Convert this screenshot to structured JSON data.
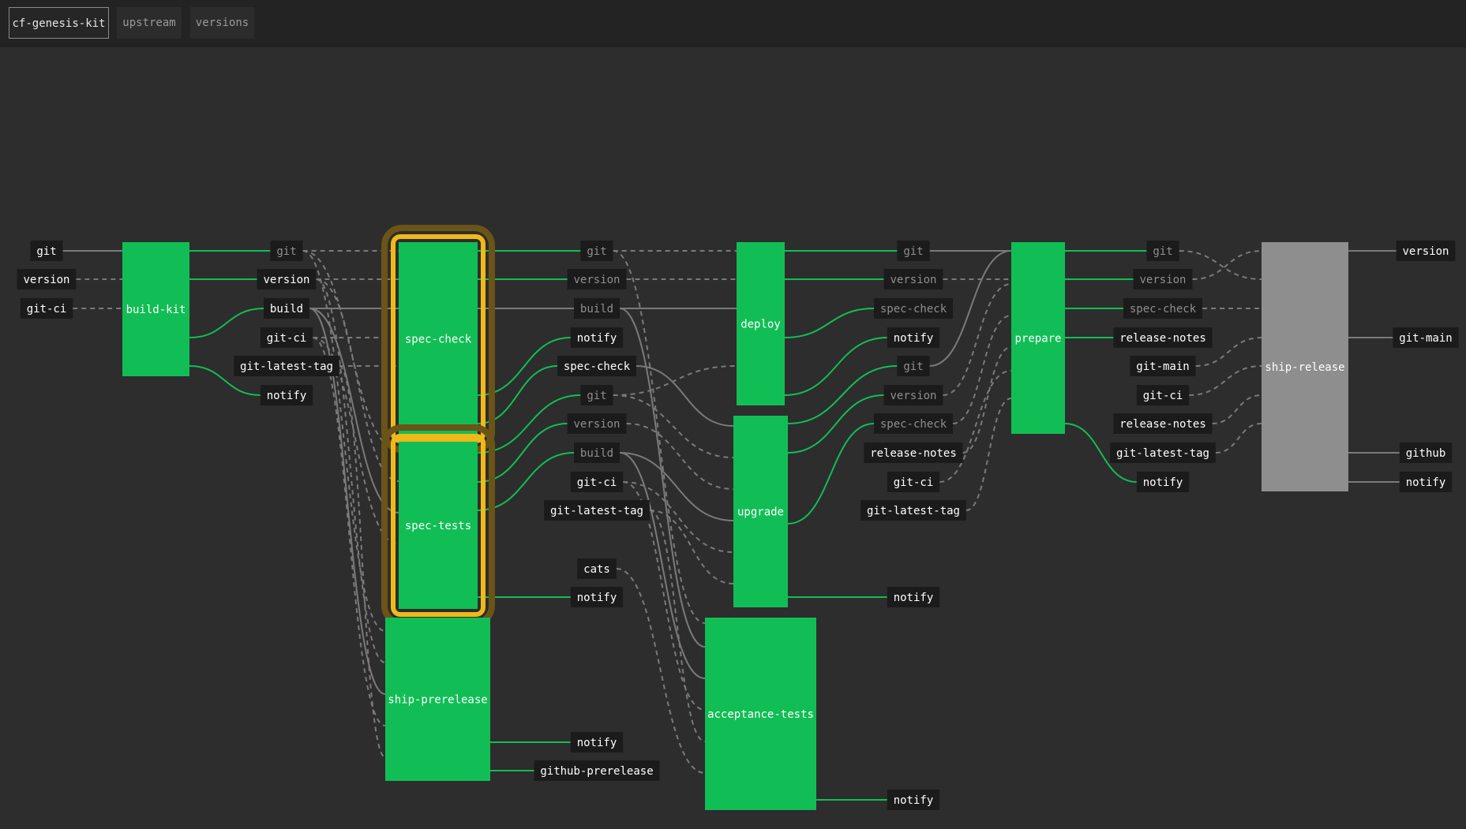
{
  "tabs": [
    {
      "label": "cf-genesis-kit",
      "active": true
    },
    {
      "label": "upstream",
      "active": false
    },
    {
      "label": "versions",
      "active": false
    }
  ],
  "colors": {
    "succeeded": "#11be55",
    "pending": "#8e8e8e",
    "running": "#f0b91a",
    "running_halo": "#6b5417",
    "label_bg": "#1b1b1b",
    "label_text": "#ffffff",
    "label_text_dim": "#8f8f8f",
    "edge": "#7a7a7a",
    "edge_green": "#11be55"
  },
  "jobs": [
    {
      "id": "build-kit",
      "label": "build-kit",
      "status": "succeeded"
    },
    {
      "id": "spec-check",
      "label": "spec-check",
      "status": "running"
    },
    {
      "id": "spec-tests",
      "label": "spec-tests",
      "status": "running"
    },
    {
      "id": "ship-prerelease",
      "label": "ship-prerelease",
      "status": "succeeded"
    },
    {
      "id": "deploy",
      "label": "deploy",
      "status": "succeeded"
    },
    {
      "id": "upgrade",
      "label": "upgrade",
      "status": "succeeded"
    },
    {
      "id": "acceptance-tests",
      "label": "acceptance-tests",
      "status": "succeeded"
    },
    {
      "id": "prepare",
      "label": "prepare",
      "status": "succeeded"
    },
    {
      "id": "ship-release",
      "label": "ship-release",
      "status": "pending"
    }
  ],
  "resources": [
    {
      "id": "r-c0-git",
      "text": "git",
      "dim": false
    },
    {
      "id": "r-c0-version",
      "text": "version",
      "dim": false
    },
    {
      "id": "r-c0-git-ci",
      "text": "git-ci",
      "dim": false
    },
    {
      "id": "r-c1-git",
      "text": "git",
      "dim": true
    },
    {
      "id": "r-c1-version",
      "text": "version",
      "dim": false
    },
    {
      "id": "r-c1-build",
      "text": "build",
      "dim": false
    },
    {
      "id": "r-c1-git-ci",
      "text": "git-ci",
      "dim": false
    },
    {
      "id": "r-c1-git-latest-tag",
      "text": "git-latest-tag",
      "dim": false
    },
    {
      "id": "r-c1-notify",
      "text": "notify",
      "dim": false
    },
    {
      "id": "r-c2-git",
      "text": "git",
      "dim": true
    },
    {
      "id": "r-c2-version",
      "text": "version",
      "dim": true
    },
    {
      "id": "r-c2-build",
      "text": "build",
      "dim": true
    },
    {
      "id": "r-c2-notify",
      "text": "notify",
      "dim": false
    },
    {
      "id": "r-c2-spec-check",
      "text": "spec-check",
      "dim": false
    },
    {
      "id": "r-c2-git-b",
      "text": "git",
      "dim": true
    },
    {
      "id": "r-c2-version-b",
      "text": "version",
      "dim": true
    },
    {
      "id": "r-c2-build-b",
      "text": "build",
      "dim": true
    },
    {
      "id": "r-c2-git-ci",
      "text": "git-ci",
      "dim": false
    },
    {
      "id": "r-c2-git-latest-tag",
      "text": "git-latest-tag",
      "dim": false
    },
    {
      "id": "r-c2-cats",
      "text": "cats",
      "dim": false
    },
    {
      "id": "r-c2-notify-b",
      "text": "notify",
      "dim": false
    },
    {
      "id": "r-c2-notify-c",
      "text": "notify",
      "dim": false
    },
    {
      "id": "r-c2-github-prerelease",
      "text": "github-prerelease",
      "dim": false
    },
    {
      "id": "r-c3-git",
      "text": "git",
      "dim": true
    },
    {
      "id": "r-c3-version",
      "text": "version",
      "dim": true
    },
    {
      "id": "r-c3-spec-check",
      "text": "spec-check",
      "dim": true
    },
    {
      "id": "r-c3-notify",
      "text": "notify",
      "dim": false
    },
    {
      "id": "r-c3-git-b",
      "text": "git",
      "dim": true
    },
    {
      "id": "r-c3-version-b",
      "text": "version",
      "dim": true
    },
    {
      "id": "r-c3-spec-check-b",
      "text": "spec-check",
      "dim": true
    },
    {
      "id": "r-c3-release-notes",
      "text": "release-notes",
      "dim": false
    },
    {
      "id": "r-c3-git-ci",
      "text": "git-ci",
      "dim": false
    },
    {
      "id": "r-c3-git-latest-tag",
      "text": "git-latest-tag",
      "dim": false
    },
    {
      "id": "r-c3-notify-b",
      "text": "notify",
      "dim": false
    },
    {
      "id": "r-c3-notify-c",
      "text": "notify",
      "dim": false
    },
    {
      "id": "r-c4-git",
      "text": "git",
      "dim": true
    },
    {
      "id": "r-c4-version",
      "text": "version",
      "dim": true
    },
    {
      "id": "r-c4-spec-check",
      "text": "spec-check",
      "dim": true
    },
    {
      "id": "r-c4-release-notes",
      "text": "release-notes",
      "dim": false
    },
    {
      "id": "r-c4-git-main",
      "text": "git-main",
      "dim": false
    },
    {
      "id": "r-c4-git-ci",
      "text": "git-ci",
      "dim": false
    },
    {
      "id": "r-c4-release-notes-b",
      "text": "release-notes",
      "dim": false
    },
    {
      "id": "r-c4-git-latest-tag",
      "text": "git-latest-tag",
      "dim": false
    },
    {
      "id": "r-c4-notify",
      "text": "notify",
      "dim": false
    },
    {
      "id": "r-c5-version",
      "text": "version",
      "dim": false
    },
    {
      "id": "r-c5-git-main",
      "text": "git-main",
      "dim": false
    },
    {
      "id": "r-c5-github",
      "text": "github",
      "dim": false
    },
    {
      "id": "r-c5-notify",
      "text": "notify",
      "dim": false
    }
  ]
}
